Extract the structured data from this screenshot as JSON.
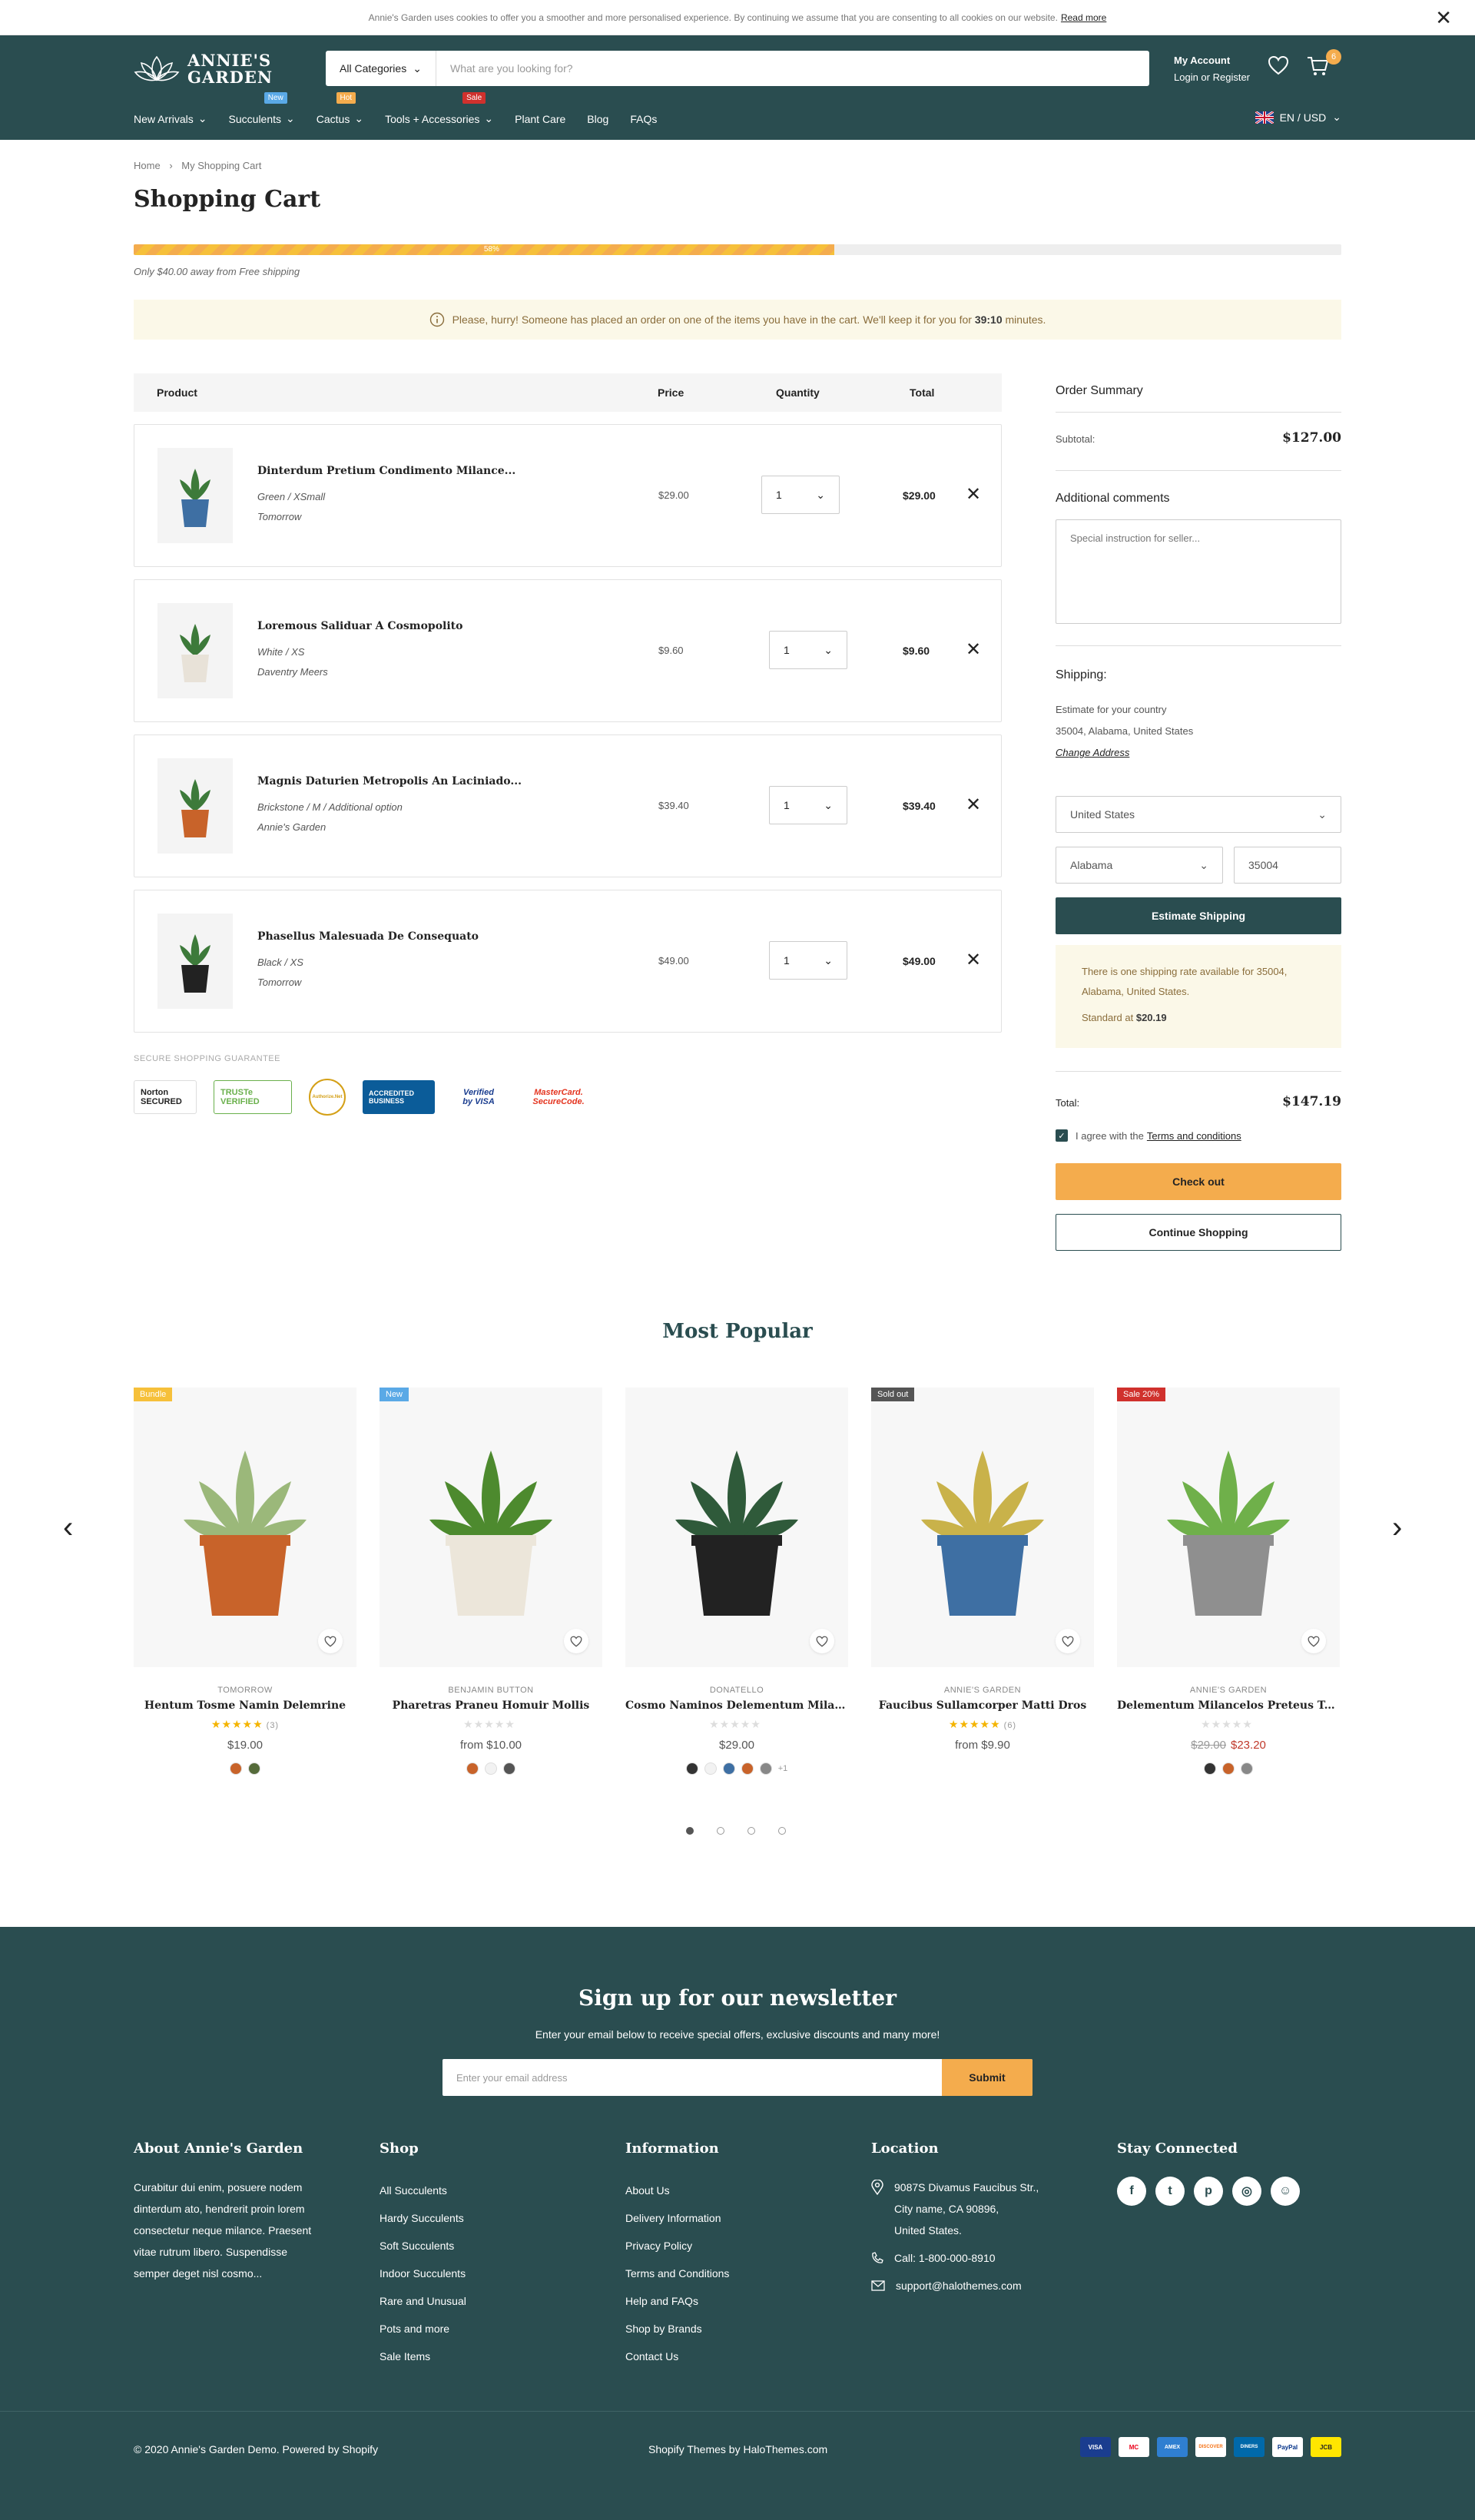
{
  "cookie": {
    "text": "Annie's Garden uses cookies to offer you a smoother and more personalised experience. By continuing we assume that you are consenting to all cookies on our website.",
    "link": "Read more",
    "close": "✕"
  },
  "header": {
    "logo_line1": "ANNIE'S",
    "logo_line2": "GARDEN",
    "category_select": "All Categories",
    "search_placeholder": "What are you looking for?",
    "account_title": "My Account",
    "account_sub": "Login or Register",
    "cart_count": "6",
    "nav": [
      {
        "label": "New Arrivals",
        "badge": ""
      },
      {
        "label": "Succulents",
        "badge": "New",
        "badge_color": "#5aa9e6"
      },
      {
        "label": "Cactus",
        "badge": "Hot",
        "badge_color": "#f4ac4d"
      },
      {
        "label": "Tools + Accessories",
        "badge": "Sale",
        "badge_color": "#d0312d"
      },
      {
        "label": "Plant Care",
        "badge": ""
      },
      {
        "label": "Blog",
        "badge": ""
      },
      {
        "label": "FAQs",
        "badge": ""
      }
    ],
    "lang": "EN / USD"
  },
  "breadcrumb": {
    "home": "Home",
    "sep": "›",
    "current": "My Shopping Cart"
  },
  "page_title": "Shopping Cart",
  "free_shipping": {
    "progress": 58,
    "pct_label": "58%",
    "note": "Only $40.00 away from Free shipping"
  },
  "hurry": {
    "pre": "Please, hurry! Someone has placed an order on one of the items you have in the cart. We'll keep it for you for",
    "time": "39:10",
    "post": "minutes."
  },
  "table_head": {
    "product": "Product",
    "price": "Price",
    "quantity": "Quantity",
    "total": "Total"
  },
  "cart_items": [
    {
      "name": "Dinterdum Pretium Condimento Milance...",
      "options": "Green  /  XSmall",
      "vendor": "Tomorrow",
      "price": "$29.00",
      "qty": "1",
      "total": "$29.00",
      "plant_color": "#3e6fa3"
    },
    {
      "name": "Loremous Saliduar A Cosmopolito",
      "options": "White  /  XS",
      "vendor": "Daventry Meers",
      "price": "$9.60",
      "qty": "1",
      "total": "$9.60",
      "plant_color": "#e8e2d8"
    },
    {
      "name": "Magnis Daturien Metropolis An Laciniado...",
      "options": "Brickstone  /  M  /  Additional option",
      "vendor": "Annie's Garden",
      "price": "$39.40",
      "qty": "1",
      "total": "$39.40",
      "plant_color": "#c8632a"
    },
    {
      "name": "Phasellus Malesuada De Consequato",
      "options": "Black  /  XS",
      "vendor": "Tomorrow",
      "price": "$49.00",
      "qty": "1",
      "total": "$49.00",
      "plant_color": "#222222"
    }
  ],
  "guarantee": {
    "label": "SECURE SHOPPING GUARANTEE",
    "seals": [
      "Norton SECURED",
      "TRUSTe VERIFIED",
      "Authorize.Net",
      "ACCREDITED BUSINESS",
      "Verified by VISA",
      "MasterCard. SecureCode."
    ]
  },
  "summary": {
    "title": "Order Summary",
    "subtotal_label": "Subtotal:",
    "subtotal": "$127.00",
    "comments_label": "Additional comments",
    "comments_placeholder": "Special instruction for seller...",
    "shipping_label": "Shipping:",
    "estimate_line1": "Estimate for your country",
    "estimate_line2": "35004, Alabama, United States",
    "change_address": "Change Address",
    "country": "United States",
    "state": "Alabama",
    "zip": "35004",
    "estimate_btn": "Estimate Shipping",
    "rates_text": "There is one shipping rate available for 35004, Alabama, United States.",
    "rates_standard": "Standard at",
    "rates_price": "$20.19",
    "total_label": "Total:",
    "total": "$147.19",
    "agree_pre": "I agree with the",
    "agree_link": "Terms and conditions",
    "checkout": "Check out",
    "continue": "Continue Shopping"
  },
  "most_popular": {
    "title": "Most Popular",
    "prev": "‹",
    "next": "›",
    "products": [
      {
        "badge": "Bundle",
        "badge_color": "#f6c03a",
        "vendor": "TOMORROW",
        "name": "Hentum Tosme Namin Delemrine",
        "rated": true,
        "stars": "★★★★★",
        "reviews": "(3)",
        "old_price": "",
        "price": "$19.00",
        "sale": false,
        "swatches": [
          "#c8632a",
          "#556b3a"
        ],
        "more": "",
        "pot": "#c8632a",
        "leaf": "#9bb87a"
      },
      {
        "badge": "New",
        "badge_color": "#5aa9e6",
        "vendor": "BENJAMIN BUTTON",
        "name": "Pharetras Praneu Homuir Mollis",
        "rated": false,
        "stars": "★★★★★",
        "reviews": "",
        "old_price": "",
        "price": "from $10.00",
        "sale": false,
        "swatches": [
          "#c8632a",
          "#f2f2f2",
          "#555555"
        ],
        "more": "",
        "pot": "#ece6da",
        "leaf": "#4d8a2e"
      },
      {
        "badge": "",
        "badge_color": "",
        "vendor": "DONATELLO",
        "name": "Cosmo Naminos Delementum Milance...",
        "rated": false,
        "stars": "★★★★★",
        "reviews": "",
        "old_price": "",
        "price": "$29.00",
        "sale": false,
        "swatches": [
          "#333333",
          "#f2f2f2",
          "#3e6fa3",
          "#c8632a",
          "#888888"
        ],
        "more": "+1",
        "pot": "#222222",
        "leaf": "#2f5a3a"
      },
      {
        "badge": "Sold out",
        "badge_color": "#555555",
        "vendor": "ANNIE'S GARDEN",
        "name": "Faucibus Sullamcorper Matti Dros",
        "rated": true,
        "stars": "★★★★★",
        "reviews": "(6)",
        "old_price": "",
        "price": "from $9.90",
        "sale": false,
        "swatches": [],
        "more": "",
        "pot": "#3e6fa3",
        "leaf": "#c9b24a"
      },
      {
        "badge": "Sale 20%",
        "badge_color": "#d0312d",
        "vendor": "ANNIE'S GARDEN",
        "name": "Delementum Milancelos Preteus Tomuir",
        "rated": false,
        "stars": "★★★★★",
        "reviews": "",
        "old_price": "$29.00",
        "price": "$23.20",
        "sale": true,
        "swatches": [
          "#333333",
          "#c8632a",
          "#888888"
        ],
        "more": "",
        "pot": "#8f8f8f",
        "leaf": "#6fb04a"
      }
    ]
  },
  "footer": {
    "nl_title": "Sign up for our newsletter",
    "nl_sub": "Enter your email below to receive special offers, exclusive discounts and many more!",
    "nl_placeholder": "Enter your email address",
    "nl_submit": "Submit",
    "about_title": "About Annie's Garden",
    "about_text": "Curabitur dui enim, posuere nodem dinterdum ato, hendrerit proin lorem consectetur neque milance. Praesent vitae rutrum libero. Suspendisse semper deget nisl cosmo...",
    "shop_title": "Shop",
    "shop_links": [
      "All Succulents",
      "Hardy Succulents",
      "Soft Succulents",
      "Indoor Succulents",
      "Rare and Unusual",
      "Pots and more",
      "Sale Items"
    ],
    "info_title": "Information",
    "info_links": [
      "About Us",
      "Delivery Information",
      "Privacy Policy",
      "Terms and Conditions",
      "Help and FAQs",
      "Shop by Brands",
      "Contact Us"
    ],
    "loc_title": "Location",
    "address_1": "9087S Divamus Faucibus Str.,",
    "address_2": "City name, CA 90896,",
    "address_3": "United States.",
    "phone": "Call: 1-800-000-8910",
    "email": "support@halothemes.com",
    "social_title": "Stay Connected",
    "social": [
      "f",
      "t",
      "p",
      "◎",
      "☺"
    ],
    "copyright": "© 2020 Annie's Garden Demo. Powered by Shopify",
    "credit": "Shopify Themes by HaloThemes.com",
    "payments": [
      "VISA",
      "MC",
      "AMEX",
      "DISCOVER",
      "DINERS",
      "PayPal",
      "JCB"
    ]
  },
  "colors": {
    "primary": "#2a4d50",
    "accent": "#f4ac4d",
    "notice": "#fbf8e8"
  }
}
